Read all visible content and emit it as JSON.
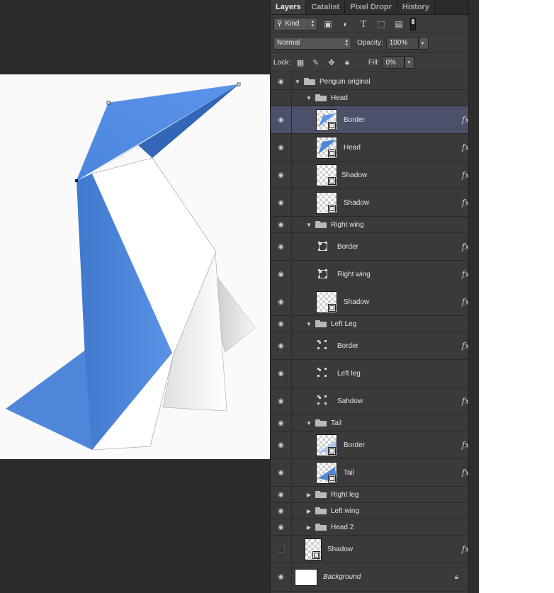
{
  "panel": {
    "tabs": [
      {
        "label": "Layers",
        "active": true
      },
      {
        "label": "Catalist",
        "active": false
      },
      {
        "label": "Pixel Dropr",
        "active": false
      },
      {
        "label": "History",
        "active": false
      }
    ],
    "filter": {
      "kind_label": "Kind"
    },
    "blend": {
      "mode": "Normal",
      "opacity_label": "Opacity:",
      "opacity": "100%"
    },
    "lock": {
      "label": "Lock:",
      "fill_label": "Fill:",
      "fill": "0%"
    }
  },
  "layers": {
    "penguin_original": "Penguin original",
    "head_group": "Head",
    "head_border": "Border",
    "head_head": "Head",
    "head_shadow1": "Shadow",
    "head_shadow2": "Shadow",
    "rightwing_group": "Right wing",
    "rightwing_border": "Border",
    "rightwing_rightwing": "Right wing",
    "rightwing_shadow": "Shadow",
    "leftleg_group": "Left Leg",
    "leftleg_border": "Border",
    "leftleg_leftleg": "Left leg",
    "leftleg_sahdow": "Sahdow",
    "tail_group": "Tail",
    "tail_border": "Border",
    "tail_tail": "Tail",
    "rightleg_group": "Right leg",
    "leftwing_group": "Left wing",
    "head2_group": "Head 2",
    "shadow_layer": "Shadow",
    "background": "Background"
  },
  "colors": {
    "accent_blue": "#4f86d9",
    "selection": "#4a5169",
    "panel_bg": "#3c3c3c"
  }
}
